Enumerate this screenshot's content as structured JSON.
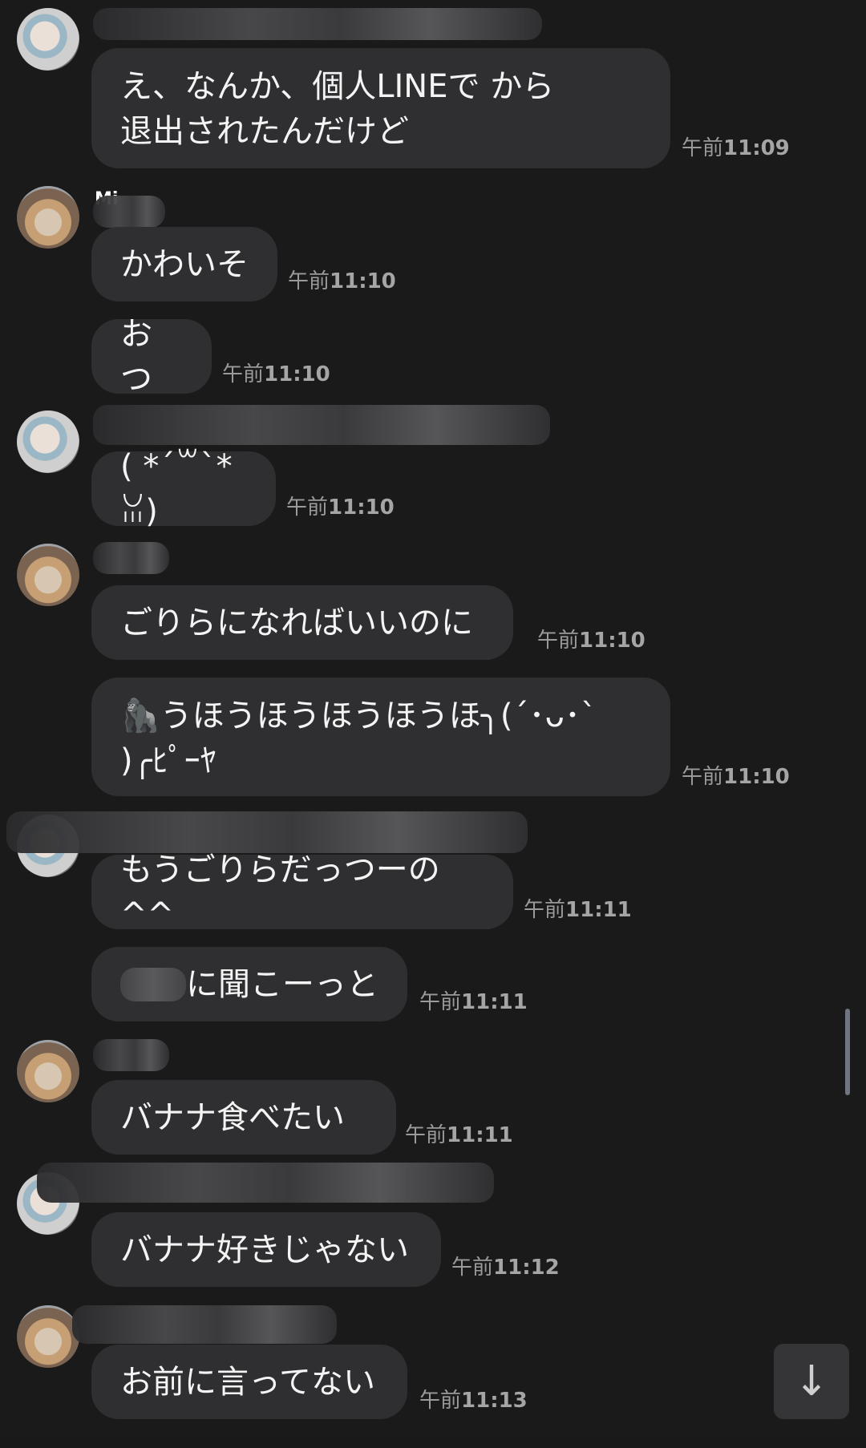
{
  "messages": [
    {
      "text": "え、なんか、個人LINEで  から\n退出されたんだけど",
      "time_prefix": "午前",
      "time_value": "11:09"
    },
    {
      "name": "Mi",
      "text": "かわいそ",
      "time_prefix": "午前",
      "time_value": "11:10"
    },
    {
      "text": "おつ",
      "time_prefix": "午前",
      "time_value": "11:10"
    },
    {
      "text": "( *´꒳`*ꈍ)",
      "time_prefix": "午前",
      "time_value": "11:10"
    },
    {
      "text": "ごりらになればいいのに",
      "time_prefix": "午前",
      "time_value": "11:10"
    },
    {
      "text": "🦍うほうほうほうほうほ╮(´･ᴗ･`\n)╭ﾋﾟｰﾔ",
      "time_prefix": "午前",
      "time_value": "11:10"
    },
    {
      "text": "もうごりらだっつーの^^",
      "time_prefix": "午前",
      "time_value": "11:11"
    },
    {
      "text": "に聞こーっと",
      "time_prefix": "午前",
      "time_value": "11:11"
    },
    {
      "text": "バナナ食べたい",
      "time_prefix": "午前",
      "time_value": "11:11"
    },
    {
      "text": "バナナ好きじゃない",
      "time_prefix": "午前",
      "time_value": "11:12"
    },
    {
      "text": "お前に言ってない",
      "time_prefix": "午前",
      "time_value": "11:13"
    }
  ],
  "jump_to_latest_icon": "arrow-down-icon",
  "colors": {
    "background": "#1a1a1b",
    "bubble": "#2f2f31",
    "timestamp": "#9a9a9a"
  }
}
